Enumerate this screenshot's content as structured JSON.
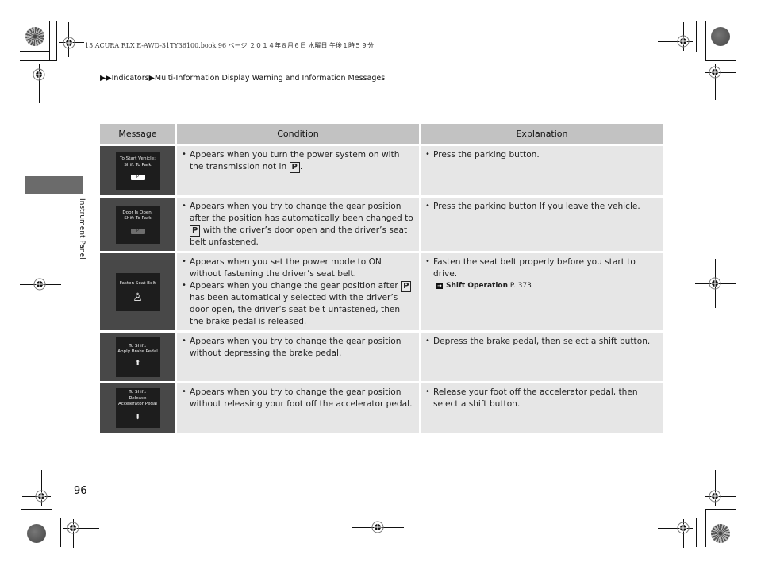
{
  "print_header": {
    "meta_text": "15 ACURA RLX E-AWD-31TY36100.book  96 ページ  ２０１４年８月６日  水曜日  午後１時５９分"
  },
  "breadcrumb": {
    "marker": "▶▶",
    "items": [
      "Indicators",
      "Multi-Information Display Warning and Information Messages"
    ],
    "separator": "▶"
  },
  "side_tab": {
    "label": "Instrument Panel"
  },
  "table": {
    "headers": [
      "Message",
      "Condition",
      "Explanation"
    ],
    "rows": [
      {
        "message_display": {
          "lines": [
            "To Start Vehicle:",
            "Shift To Park"
          ],
          "icon": "p-button-icon",
          "button_label": "P",
          "button_style": "white"
        },
        "conditions": [
          {
            "before": "Appears when you turn the power system on with the transmission not in ",
            "key": "P",
            "after": "."
          }
        ],
        "explanations": [
          {
            "text": "Press the parking button."
          }
        ]
      },
      {
        "message_display": {
          "lines": [
            "Door Is Open.",
            "Shift To Park"
          ],
          "icon": "p-button-icon",
          "button_label": "P",
          "button_style": "gray"
        },
        "conditions": [
          {
            "before": "Appears when you try to change the gear position after the position has automatically been changed to ",
            "key": "P",
            "after": " with the driver’s door open and the driver’s seat belt unfastened."
          }
        ],
        "explanations": [
          {
            "text": "Press the parking button If you leave the vehicle."
          }
        ]
      },
      {
        "message_display": {
          "lines": [
            "Fasten Seat Belt"
          ],
          "icon": "seatbelt-icon",
          "glyph": "♙"
        },
        "conditions": [
          {
            "before": "Appears when you set the power mode to ON without fastening the driver’s seat belt.",
            "key": "",
            "after": ""
          },
          {
            "before": "Appears when you change the gear position after ",
            "key": "P",
            "after": " has been automatically selected with the driver’s door open, the driver’s seat belt unfastened, then the brake pedal is released."
          }
        ],
        "explanations": [
          {
            "text": "Fasten the seat belt properly before you start to drive."
          }
        ],
        "cross_ref": {
          "icon": "cross-reference-icon",
          "glyph": "➔",
          "title": "Shift Operation",
          "page": "P. 373"
        }
      },
      {
        "message_display": {
          "lines": [
            "To Shift:",
            "Apply Brake Pedal"
          ],
          "icon": "brake-pedal-icon",
          "glyph": "⬆"
        },
        "conditions": [
          {
            "before": "Appears when you try to change the gear position without depressing the brake pedal.",
            "key": "",
            "after": ""
          }
        ],
        "explanations": [
          {
            "text": "Depress the brake pedal, then select a shift button."
          }
        ]
      },
      {
        "message_display": {
          "lines": [
            "To Shift:",
            "Release",
            "Accelerator Pedal"
          ],
          "icon": "accelerator-pedal-icon",
          "glyph": "⬇"
        },
        "conditions": [
          {
            "before": "Appears when you try to change the gear position without releasing your foot off the accelerator pedal.",
            "key": "",
            "after": ""
          }
        ],
        "explanations": [
          {
            "text": "Release your foot off the accelerator pedal, then select a shift button."
          }
        ]
      }
    ]
  },
  "page_number": "96"
}
